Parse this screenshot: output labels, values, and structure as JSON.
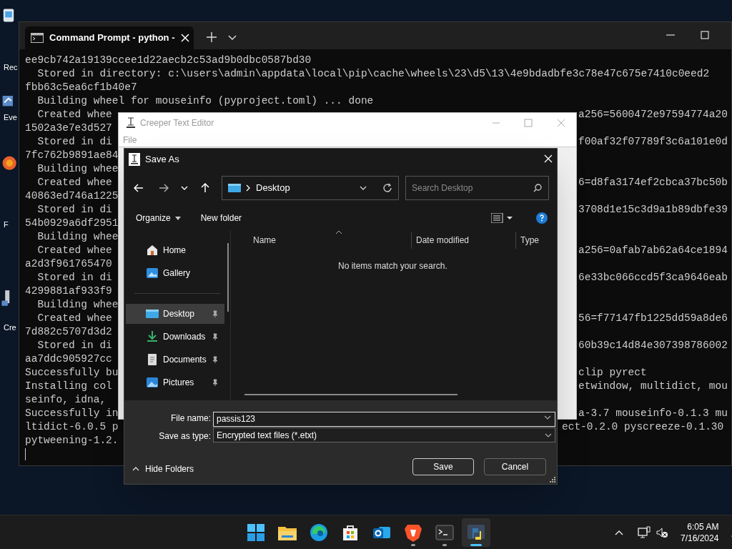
{
  "desktop_icons": [
    {
      "label": "Rec"
    },
    {
      "label": "Eve"
    },
    {
      "label": "F"
    },
    {
      "label": "Cre"
    }
  ],
  "terminal": {
    "tab_title": "Command Prompt - python -",
    "lines": [
      {
        "kind": "full",
        "text": "ee9cb742a19139ccee1d22aecb2c53ad9b0dbc0587bd30"
      },
      {
        "kind": "full",
        "text": "  Stored in directory: c:\\users\\admin\\appdata\\local\\pip\\cache\\wheels\\23\\d5\\13\\4e9bdadbfe3c78e47c675e7410c0eed2"
      },
      {
        "kind": "full",
        "text": "fbb63c5ea6cf1b40e7"
      },
      {
        "kind": "full",
        "text": "  Building wheel for mouseinfo (pyproject.toml) ... done"
      },
      {
        "kind": "editor",
        "left": "  Created whee",
        "right": "a256=5600472e97594774a20"
      },
      {
        "kind": "editor",
        "left": "1502a3e7e3d527"
      },
      {
        "kind": "editor",
        "left": "  Stored in di",
        "right": "f00af32f07789f3c6a101e0d"
      },
      {
        "kind": "editor",
        "left": "7fc762b9891ae84"
      },
      {
        "kind": "editor",
        "left": "  Building whee"
      },
      {
        "kind": "editor",
        "left": "  Created whee",
        "right": "6=d8fa3174ef2cbca37bc50b"
      },
      {
        "kind": "editor",
        "left": "40863ed746a1225"
      },
      {
        "kind": "editor",
        "left": "  Stored in di",
        "right": "3708d1e15c3d9a1b89dbfe39"
      },
      {
        "kind": "editor",
        "left": "54b0929a6df2951"
      },
      {
        "kind": "editor",
        "left": "  Building whee"
      },
      {
        "kind": "editor",
        "left": "  Created whee",
        "right": "a256=0afab7ab62a64ce1894"
      },
      {
        "kind": "editor",
        "left": "a2d3f961765470"
      },
      {
        "kind": "editor",
        "left": "  Stored in di",
        "right": "6e33bc066ccd5f3ca9646eab"
      },
      {
        "kind": "editor",
        "left": "4299881af933f9"
      },
      {
        "kind": "editor",
        "left": "  Building whee"
      },
      {
        "kind": "editor",
        "left": "  Created whee",
        "right": "56=f77147fb1225dd59a8de6"
      },
      {
        "kind": "editor",
        "left": "7d882c5707d3d2"
      },
      {
        "kind": "editor",
        "left": "  Stored in di",
        "right": "60b39c14d84e307398786002"
      },
      {
        "kind": "editor",
        "left": "aa7ddc905927cc"
      },
      {
        "kind": "editor",
        "left": "Successfully bu",
        "right": "clip pyrect"
      },
      {
        "kind": "editor",
        "left": "Installing col",
        "right": "etwindow, multidict, mou"
      },
      {
        "kind": "editor",
        "left": "seinfo, idna, "
      },
      {
        "kind": "editor",
        "left": "Successfully in",
        "right": "a-3.7 mouseinfo-0.1.3 mu"
      },
      {
        "kind": "dialog",
        "left": "ltidict-6.0.5 p",
        "right": "ect-0.2.0 pyscreeze-0.1.30"
      },
      {
        "kind": "dialog",
        "left": "pytweening-1.2."
      }
    ]
  },
  "editor": {
    "title": "Creeper Text Editor",
    "menu": [
      "File"
    ]
  },
  "dialog": {
    "title": "Save As",
    "address": "Desktop",
    "search_placeholder": "Search Desktop",
    "organize": "Organize",
    "new_folder": "New folder",
    "nav": [
      {
        "kind": "home",
        "label": "Home",
        "pinned": false,
        "selected": false
      },
      {
        "kind": "gallery",
        "label": "Gallery",
        "pinned": false,
        "selected": false
      },
      {
        "kind": "desktop",
        "label": "Desktop",
        "pinned": true,
        "selected": true
      },
      {
        "kind": "downloads",
        "label": "Downloads",
        "pinned": true,
        "selected": false
      },
      {
        "kind": "documents",
        "label": "Documents",
        "pinned": true,
        "selected": false
      },
      {
        "kind": "pictures",
        "label": "Pictures",
        "pinned": true,
        "selected": false
      }
    ],
    "columns": [
      "Name",
      "Date modified",
      "Type"
    ],
    "empty_message": "No items match your search.",
    "file_name_label": "File name:",
    "file_name": "passis123",
    "type_label": "Save as type:",
    "type_value": "Encrypted text files (*.etxt)",
    "hide_folders": "Hide Folders",
    "save": "Save",
    "cancel": "Cancel"
  },
  "taskbar": {
    "apps": [
      {
        "kind": "start",
        "running": false,
        "active": false
      },
      {
        "kind": "explorer",
        "running": false,
        "active": false
      },
      {
        "kind": "edge",
        "running": false,
        "active": false
      },
      {
        "kind": "store",
        "running": false,
        "active": false
      },
      {
        "kind": "outlook",
        "running": false,
        "active": false
      },
      {
        "kind": "brave",
        "running": true,
        "active": false
      },
      {
        "kind": "terminal",
        "running": true,
        "active": false
      },
      {
        "kind": "python",
        "running": true,
        "active": true
      }
    ],
    "time": "6:05 AM",
    "date": "7/16/2024"
  }
}
